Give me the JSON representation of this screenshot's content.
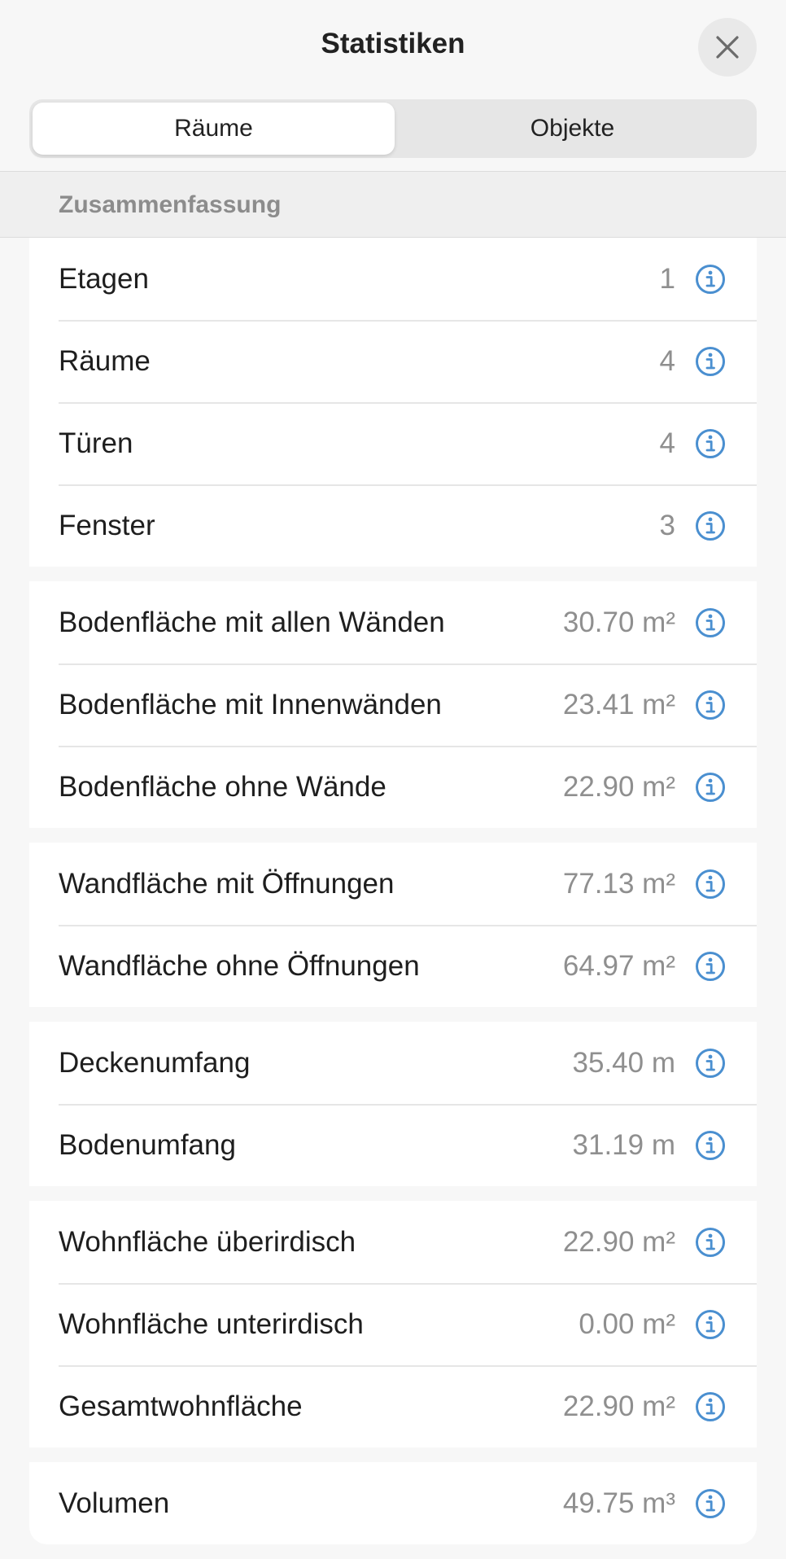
{
  "header": {
    "title": "Statistiken"
  },
  "tabs": [
    {
      "label": "Räume",
      "active": true
    },
    {
      "label": "Objekte",
      "active": false
    }
  ],
  "section": {
    "title": "Zusammenfassung"
  },
  "groups": [
    {
      "rows": [
        {
          "label": "Etagen",
          "value": "1"
        },
        {
          "label": "Räume",
          "value": "4"
        },
        {
          "label": "Türen",
          "value": "4"
        },
        {
          "label": "Fenster",
          "value": "3"
        }
      ]
    },
    {
      "rows": [
        {
          "label": "Bodenfläche mit allen Wänden",
          "value": "30.70 m²"
        },
        {
          "label": "Bodenfläche mit Innenwänden",
          "value": "23.41 m²"
        },
        {
          "label": "Bodenfläche ohne Wände",
          "value": "22.90 m²"
        }
      ]
    },
    {
      "rows": [
        {
          "label": "Wandfläche mit Öffnungen",
          "value": "77.13 m²"
        },
        {
          "label": "Wandfläche ohne Öffnungen",
          "value": "64.97 m²"
        }
      ]
    },
    {
      "rows": [
        {
          "label": "Deckenumfang",
          "value": "35.40 m"
        },
        {
          "label": "Bodenumfang",
          "value": "31.19 m"
        }
      ]
    },
    {
      "rows": [
        {
          "label": "Wohnfläche überirdisch",
          "value": "22.90 m²"
        },
        {
          "label": "Wohnfläche unterirdisch",
          "value": "0.00 m²"
        },
        {
          "label": "Gesamtwohnfläche",
          "value": "22.90 m²"
        }
      ]
    },
    {
      "rows": [
        {
          "label": "Volumen",
          "value": "49.75 m³"
        }
      ]
    }
  ],
  "colors": {
    "accent": "#4a8fd0",
    "background": "#f7f7f7",
    "value_text": "#8f8f8f"
  },
  "icons": {
    "close": "close-icon",
    "info": "info-icon"
  }
}
